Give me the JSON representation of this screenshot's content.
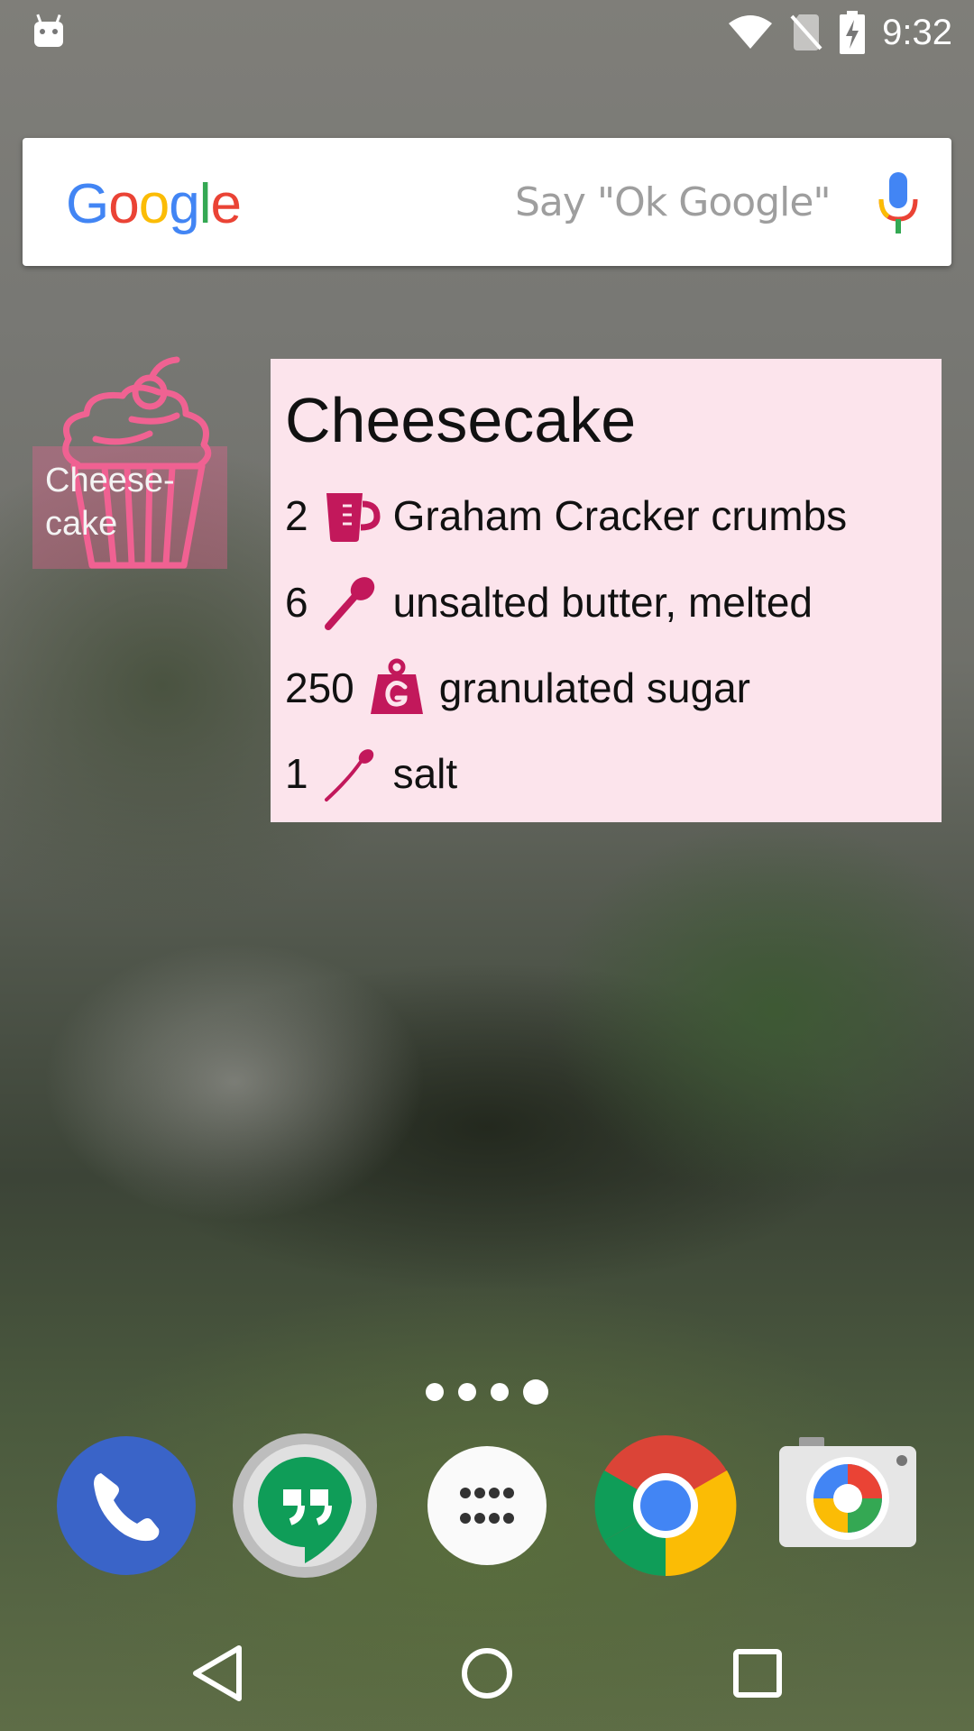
{
  "status_bar": {
    "time": "9:32",
    "icons": [
      "android-debug-icon",
      "wifi-icon",
      "no-sim-icon",
      "battery-charging-icon"
    ]
  },
  "search": {
    "logo_letters": [
      {
        "char": "G",
        "color": "#4285F4"
      },
      {
        "char": "o",
        "color": "#EA4335"
      },
      {
        "char": "o",
        "color": "#FBBC05"
      },
      {
        "char": "g",
        "color": "#4285F4"
      },
      {
        "char": "l",
        "color": "#34A853"
      },
      {
        "char": "e",
        "color": "#EA4335"
      }
    ],
    "hint": "Say \"Ok Google\"",
    "mic_icon": "mic-icon"
  },
  "shortcut": {
    "label": "Cheese-\ncake",
    "icon": "cupcake-icon",
    "icon_color": "#f06292"
  },
  "recipe": {
    "title": "Cheesecake",
    "accent_color": "#c2185b",
    "background": "#fce4ec",
    "ingredients": [
      {
        "qty": "2",
        "unit_icon": "cup-icon",
        "name": "Graham Cracker crumbs"
      },
      {
        "qty": "6",
        "unit_icon": "tablespoon-icon",
        "name": "unsalted butter, melted"
      },
      {
        "qty": "250",
        "unit_icon": "gram-weight-icon",
        "name": "granulated sugar"
      },
      {
        "qty": "1",
        "unit_icon": "teaspoon-icon",
        "name": "salt"
      }
    ]
  },
  "home_pages": {
    "count": 4,
    "active_index": 3
  },
  "dock": {
    "apps": [
      "phone-icon",
      "hangouts-icon",
      "app-drawer-icon",
      "chrome-icon",
      "camera-icon"
    ]
  },
  "nav_bar": {
    "buttons": [
      "back-icon",
      "home-icon",
      "recents-icon"
    ]
  }
}
